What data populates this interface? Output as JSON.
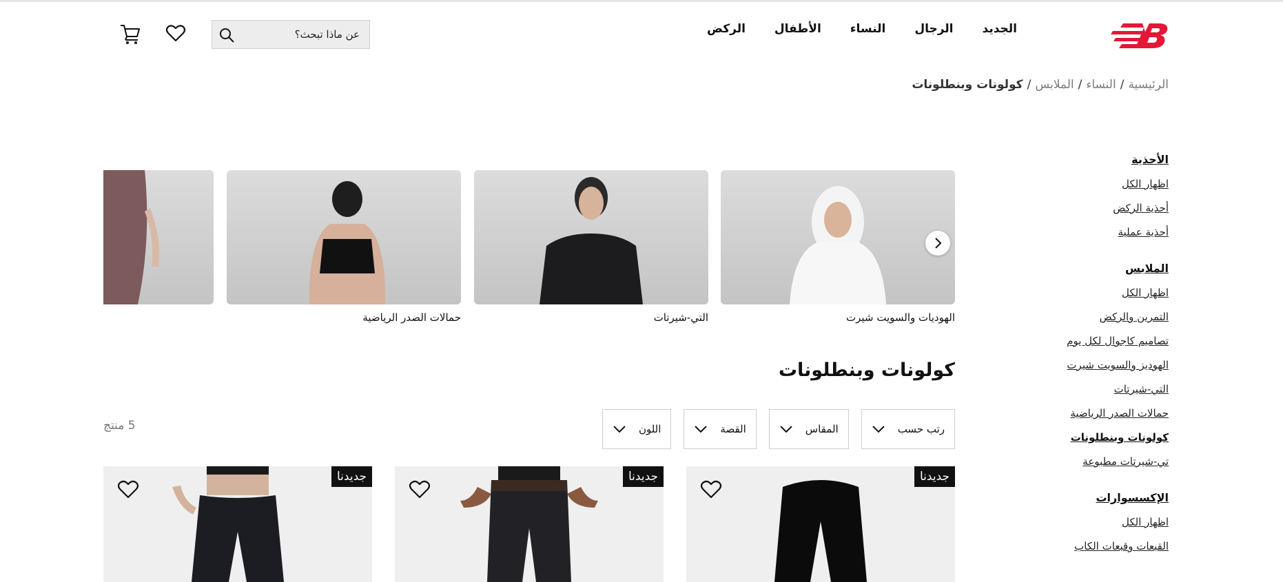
{
  "header": {
    "nav": [
      "الجديد",
      "الرجال",
      "النساء",
      "الأطفال",
      "الركض"
    ],
    "search_placeholder": "عن ماذا تبحث؟"
  },
  "breadcrumb": {
    "items": [
      "الرئيسية",
      "النساء",
      "الملابس"
    ],
    "current": "كولونات وبنطلونات",
    "separator": "/"
  },
  "sidebar": {
    "groups": [
      {
        "heading": "الأحذية",
        "links": [
          "اظهار الكل",
          "أحذية الركض",
          "أحذية عملية"
        ]
      },
      {
        "heading": "الملابس",
        "links": [
          "اظهار الكل",
          "التمرين والركض",
          "تصاميم كاجوال لكل يوم",
          "الهوديز والسويت شيرت",
          "التي-شيرتات",
          "حمالات الصدر الرياضية",
          "كولونات وبنطلونات",
          "تي-شيرتات مطبوعة"
        ]
      },
      {
        "heading": "الإكسسوارات",
        "links": [
          "اظهار الكل",
          "القبعات وقبعات الكاب"
        ]
      }
    ],
    "active_link": "كولونات وبنطلونات"
  },
  "categories": [
    {
      "label": "الهوديات والسويت شيرت"
    },
    {
      "label": "التي-شيرتات"
    },
    {
      "label": "حمالات الصدر الرياضية"
    },
    {
      "label": ""
    }
  ],
  "page_title": "كولونات وبنطلونات",
  "filters": [
    "رتب حسب",
    "المقاس",
    "القصة",
    "اللون"
  ],
  "product_count": "5 منتج",
  "products": [
    {
      "badge": "جديدنا"
    },
    {
      "badge": "جديدنا"
    },
    {
      "badge": "جديدنا"
    }
  ],
  "colors": {
    "brand_red": "#e21836",
    "text": "#111111",
    "muted": "#777777",
    "badge_bg": "#111111"
  }
}
